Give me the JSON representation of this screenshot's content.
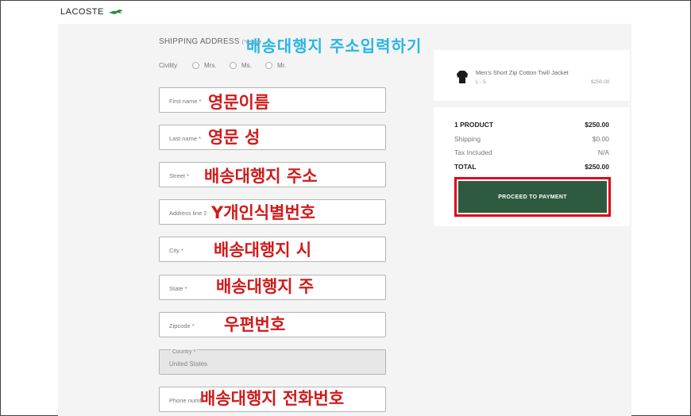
{
  "brand": {
    "name": "LACOSTE"
  },
  "form": {
    "section_title": "SHIPPING ADDRESS",
    "required_note": "(*requir",
    "civility_label": "Civility",
    "civility_options": [
      "Mrs.",
      "Ms.",
      "Mr."
    ],
    "fields": {
      "first_name": "First name *",
      "last_name": "Last name *",
      "street": "Street *",
      "address_line2": "Address line 2",
      "city": "City *",
      "state": "State *",
      "zipcode": "Zipcode *",
      "country_label": "Country *",
      "country_value": "United States",
      "phone": "Phone numb"
    }
  },
  "annotations": {
    "title": "배송대행지 주소입력하기",
    "first_name": "영문이름",
    "last_name": "영문 성",
    "street": "배송대행지 주소",
    "address_line2": "Y개인식별번호",
    "city": "배송대행지 시",
    "state": "배송대행지 주",
    "zipcode": "우편번호",
    "phone": "배송대행지 전화번호"
  },
  "summary": {
    "product_name": "Men's Short Zip Cotton Twill Jacket",
    "product_size": "L - 5",
    "product_price": "$250.00",
    "rows": [
      {
        "label": "1 PRODUCT",
        "value": "$250.00"
      },
      {
        "label": "Shipping",
        "value": "$0.00"
      },
      {
        "label": "Tax Included",
        "value": "N/A"
      },
      {
        "label": "TOTAL",
        "value": "$250.00"
      }
    ],
    "button_label": "PROCEED TO PAYMENT"
  },
  "colors": {
    "accent_green": "#2e5b3f",
    "highlight_red": "#e0001a",
    "annotation_red": "#d11a1a",
    "annotation_blue": "#29b6e6"
  }
}
